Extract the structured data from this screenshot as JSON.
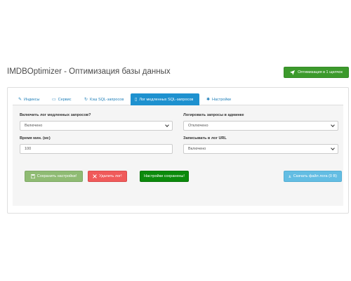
{
  "header": {
    "title": "IMDBOptimizer - Оптимизация базы данных",
    "optimize_button": "Оптимизация в 1 щелчок"
  },
  "tabs": [
    {
      "icon": "wrench-icon",
      "label": "Индексы"
    },
    {
      "icon": "laptop-icon",
      "label": "Сервис"
    },
    {
      "icon": "refresh-icon",
      "label": "Кэш SQL-запросов"
    },
    {
      "icon": "book-icon",
      "label": "Лог медленных SQL-запросов",
      "active": true
    },
    {
      "icon": "gear-icon",
      "label": "Настройки"
    }
  ],
  "form": {
    "enable_log": {
      "label": "Включить лог медленных запросов?",
      "value": "Включено"
    },
    "log_admin": {
      "label": "Логировать запросы в админке",
      "value": "Отключено"
    },
    "min_time": {
      "label": "Время мин. (мс)",
      "value": "100"
    },
    "log_url": {
      "label": "Записывать в лог URL",
      "value": "Включено"
    }
  },
  "actions": {
    "save": "Сохранить настройки!",
    "delete": "Удалить лог!",
    "saved_notice": "Настройки сохранены!",
    "download": "Скачать файл лога (0 B)"
  },
  "colors": {
    "primary": "#1e91cf",
    "success": "#3c9a2c",
    "danger": "#f05a5a",
    "info": "#63bde3"
  }
}
